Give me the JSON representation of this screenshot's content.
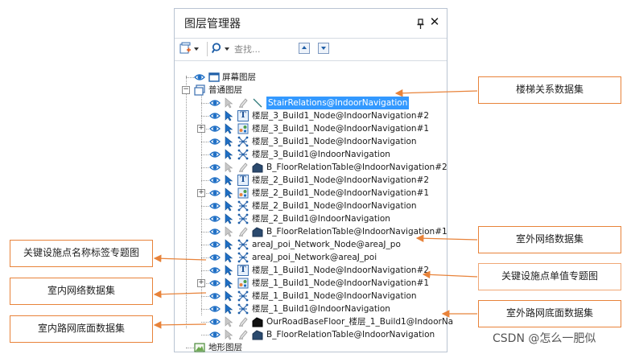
{
  "panel": {
    "title": "图层管理器",
    "search_placeholder": "查找...",
    "close_glyph": "✕",
    "pin_icon": "pin-icon",
    "add_layer_icon": "add-layer-icon",
    "search_icon": "search-icon"
  },
  "tree": {
    "screen_layer": "屏幕图层",
    "normal_layer": "普通图层",
    "terrain_layer": "地形图层",
    "layers": [
      {
        "label": "StairRelations@IndoorNavigation",
        "type": "line",
        "selected": true
      },
      {
        "label": "楼层_3_Build1_Node@IndoorNavigation#2",
        "type": "label"
      },
      {
        "label": "楼层_3_Build1_Node@IndoorNavigation#1",
        "type": "theme",
        "expandable": true
      },
      {
        "label": "楼层_3_Build1_Node@IndoorNavigation",
        "type": "network"
      },
      {
        "label": "楼层_3_Build1@IndoorNavigation",
        "type": "network"
      },
      {
        "label": "B_FloorRelationTable@IndoorNavigation#2",
        "type": "region"
      },
      {
        "label": "楼层_2_Build1_Node@IndoorNavigation#2",
        "type": "label"
      },
      {
        "label": "楼层_2_Build1_Node@IndoorNavigation#1",
        "type": "theme",
        "expandable": true
      },
      {
        "label": "楼层_2_Build1_Node@IndoorNavigation",
        "type": "network"
      },
      {
        "label": "楼层_2_Build1@IndoorNavigation",
        "type": "network"
      },
      {
        "label": "B_FloorRelationTable@IndoorNavigation#1",
        "type": "region"
      },
      {
        "label": "areaJ_poi_Network_Node@areaJ_po",
        "type": "network"
      },
      {
        "label": "areaJ_poi_Network@areaJ_poi",
        "type": "network"
      },
      {
        "label": "楼层_1_Build1_Node@IndoorNavigation#2",
        "type": "label"
      },
      {
        "label": "楼层_1_Build1_Node@IndoorNavigation#1",
        "type": "theme",
        "expandable": true
      },
      {
        "label": "楼层_1_Build1_Node@IndoorNavigation",
        "type": "network"
      },
      {
        "label": "楼层_1_Build1@IndoorNavigation",
        "type": "network"
      },
      {
        "label": "OurRoadBaseFloor_楼层_1_Build1@IndoorNa",
        "type": "region-dark"
      },
      {
        "label": "B_FloorRelationTable@IndoorNavigation",
        "type": "region"
      }
    ]
  },
  "callouts": {
    "stair": "楼梯关系数据集",
    "outdoor_network": "室外网络数据集",
    "key_facility_unique": "关键设施点单值专题图",
    "outdoor_road_base": "室外路网底面数据集",
    "key_facility_label": "关键设施点名称标签专题图",
    "indoor_network": "室内网络数据集",
    "indoor_road_base": "室内路网底面数据集"
  },
  "colors": {
    "accent_orange": "#e8833a",
    "selection_blue": "#3399ff",
    "eye_blue": "#1f6fc5"
  },
  "watermark": "CSDN @怎么一肥似"
}
